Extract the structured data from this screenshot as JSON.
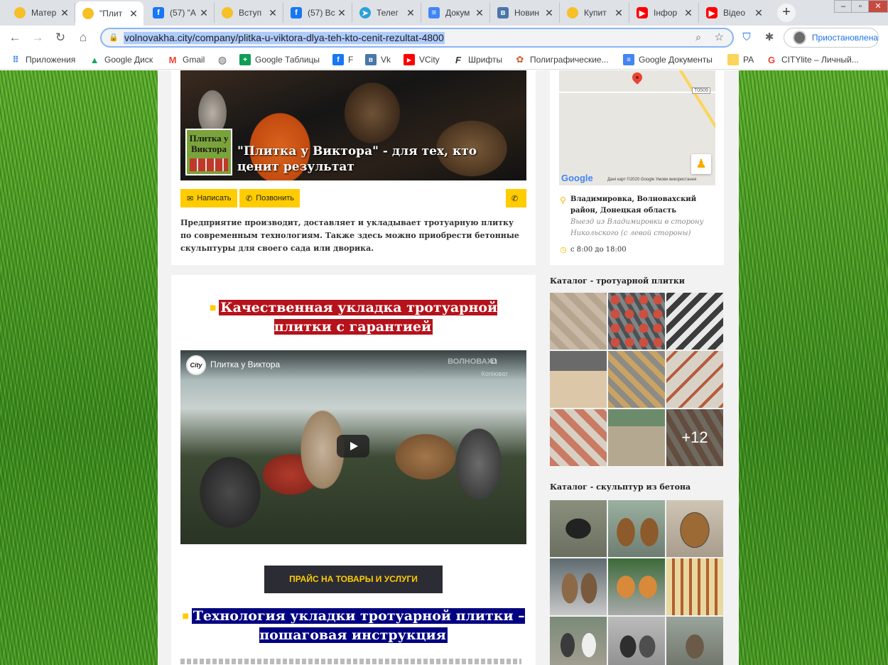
{
  "browser": {
    "tabs": [
      {
        "label": "Матер",
        "favicon": "circle-yellow-icon"
      },
      {
        "label": "\"Плит",
        "favicon": "circle-yellow-icon",
        "active": true
      },
      {
        "label": "(57) \"А",
        "favicon": "facebook-icon"
      },
      {
        "label": "Вступ",
        "favicon": "circle-yellow-icon"
      },
      {
        "label": "(57) Вс",
        "favicon": "facebook-icon"
      },
      {
        "label": "Телег",
        "favicon": "telegram-icon"
      },
      {
        "label": "Докум",
        "favicon": "docs-icon"
      },
      {
        "label": "Новин",
        "favicon": "vk-icon"
      },
      {
        "label": "Купит",
        "favicon": "circle-yellow-icon"
      },
      {
        "label": "Інфор",
        "favicon": "youtube-icon"
      },
      {
        "label": "Відео",
        "favicon": "youtube-icon"
      }
    ],
    "url": "volnovakha.city/company/plitka-u-viktora-dlya-teh-kto-cenit-rezultat-4800",
    "profile_label": "Приостановлена",
    "bookmarks": [
      {
        "label": "Приложения",
        "icon": "apps-grid-icon"
      },
      {
        "label": "Google Диск",
        "icon": "google-drive-icon"
      },
      {
        "label": "Gmail",
        "icon": "gmail-icon"
      },
      {
        "label": "",
        "icon": "globe-icon"
      },
      {
        "label": "Google Таблицы",
        "icon": "sheets-icon"
      },
      {
        "label": "F",
        "icon": "facebook-icon"
      },
      {
        "label": "Vk",
        "icon": "vk-icon"
      },
      {
        "label": "VCity",
        "icon": "youtube-icon"
      },
      {
        "label": "Шрифты",
        "icon": "font-icon"
      },
      {
        "label": "Полиграфические...",
        "icon": "palette-icon"
      },
      {
        "label": "Google Документы",
        "icon": "docs-icon"
      },
      {
        "label": "PA",
        "icon": "folder-icon"
      },
      {
        "label": "CITYlite – Личный...",
        "icon": "google-icon"
      }
    ]
  },
  "company": {
    "logo_text": "Плитка у Виктора",
    "headline": "\"Плитка у Виктора\" - для тех, кто ценит результат",
    "write_button": "Написать",
    "call_button": "Позвонить",
    "description": "Предприятие производит, доставляет и укладывает тротуарную плитку по современным технологиям. Также здесь можно приобрести бетонные скульптуры для своего сада или дворика."
  },
  "map": {
    "road_label": "Т0509",
    "logo": "Google",
    "copyright": "Дані карт ©2020 Google   Умови використання",
    "address": "Владимировка, Волновахский район, Донецкая область",
    "address_note": "Выезд из Владимировки в сторону Никольского (с левой стороны)",
    "hours": "с 8:00 до 18:00"
  },
  "main": {
    "heading1": "Качественная укладка тротуарной плитки с гарантией",
    "video_title": "Плитка у Виктора",
    "video_channel": "City",
    "video_watermark": "ВОЛНОВАХ",
    "video_copy_label": "Копіюват",
    "price_button": "ПРАЙС НА ТОВАРЫ И УСЛУГИ",
    "heading2": "Технология укладки тротуарной плитки – пошаговая инструкция"
  },
  "sidebar": {
    "catalog_tiles_title": "Каталог - тротуарной плитки",
    "catalog_more": "+12",
    "catalog_sculpt_title": "Каталог - скульптур из бетона"
  },
  "colors": {
    "accent": "#ffcc00",
    "heading_red": "#b5121b",
    "heading_blue": "#000080",
    "dark_button": "#2c2c34"
  }
}
